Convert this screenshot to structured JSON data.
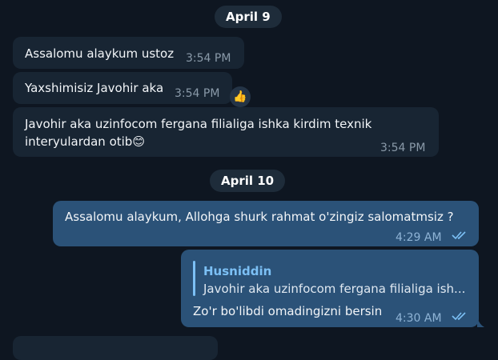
{
  "dates": [
    "April 9",
    "April 10"
  ],
  "messages": [
    {
      "text": "Assalomu alaykum ustoz",
      "time": "3:54 PM"
    },
    {
      "text": "Yaxshimisiz Javohir aka",
      "time": "3:54 PM",
      "reaction": "👍"
    },
    {
      "line1": "Javohir aka uzinfocom fergana filialiga ishka kirdim texnik",
      "line2": "interyulardan otib😊",
      "time": "3:54 PM"
    },
    {
      "text": "Assalomu alaykum, Allohga shurk rahmat o'zingiz salomatmsiz ?",
      "time": "4:29 AM"
    },
    {
      "reply_name": "Husniddin",
      "reply_text": "Javohir aka uzinfocom fergana filialiga ish...",
      "text": "Zo'r bo'libdi omadingizni bersin",
      "time": "4:30 AM"
    }
  ],
  "colors": {
    "background": "#0e1621",
    "incoming": "#182533",
    "outgoing": "#2b5278",
    "accent": "#7cc0f5"
  },
  "icons": {
    "read": "double-check-icon",
    "reaction": "thumbs-up-icon"
  }
}
